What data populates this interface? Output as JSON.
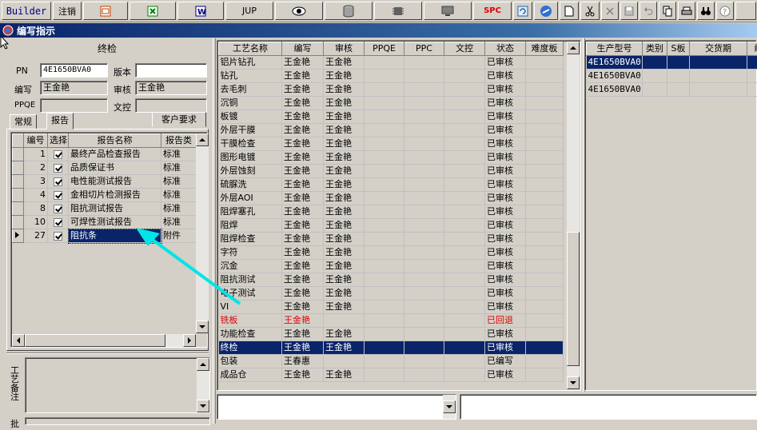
{
  "toolbar": {
    "builder": "Builder",
    "logout": "注销",
    "jup": "JUP",
    "spc": "SPC",
    "icons": [
      "word-doc-icon",
      "excel-icon",
      "word-icon",
      "eye-icon",
      "database-icon",
      "chip-icon",
      "monitor-icon",
      "refresh-icon",
      "link-icon",
      "new-file-icon",
      "cut-icon",
      "close-icon",
      "save-icon",
      "undo-icon",
      "copy-icon",
      "print-icon",
      "binoculars-icon",
      "help-icon"
    ]
  },
  "window": {
    "title": "编写指示"
  },
  "left": {
    "section_title": "终检",
    "pn_label": "PN",
    "pn_value": "4E1650BVA0",
    "version_label": "版本",
    "version_value": "",
    "writer_label": "编写",
    "writer_value": "王金艳",
    "reviewer_label": "审核",
    "reviewer_value": "王金艳",
    "ppqe_label": "PPQE",
    "ppqe_value": "",
    "doc_control_label": "文控",
    "doc_control_value": "",
    "tabs": [
      "常规",
      "报告",
      "客户要求"
    ],
    "report_headers": [
      "编号",
      "选择",
      "报告名称",
      "报告类"
    ],
    "reports": [
      {
        "no": "1",
        "checked": true,
        "name": "最终产品检查报告",
        "type": "标准"
      },
      {
        "no": "2",
        "checked": true,
        "name": "品质保证书",
        "type": "标准"
      },
      {
        "no": "3",
        "checked": true,
        "name": "电性能测试报告",
        "type": "标准"
      },
      {
        "no": "4",
        "checked": true,
        "name": "金相切片检测报告",
        "type": "标准"
      },
      {
        "no": "8",
        "checked": true,
        "name": "阻抗测试报告",
        "type": "标准"
      },
      {
        "no": "10",
        "checked": true,
        "name": "可焊性测试报告",
        "type": "标准"
      },
      {
        "no": "27",
        "checked": true,
        "name": "阻抗条",
        "type": "附件"
      }
    ],
    "process_note_label": "工艺备注",
    "bottom_label": "批"
  },
  "process": {
    "headers": [
      "工艺名称",
      "编写",
      "审核",
      "PPQE",
      "PPC",
      "文控",
      "状态",
      "难度板"
    ],
    "rows": [
      {
        "name": "铝片钻孔",
        "writer": "王金艳",
        "reviewer": "王金艳",
        "status": "已审核"
      },
      {
        "name": "钻孔",
        "writer": "王金艳",
        "reviewer": "王金艳",
        "status": "已审核"
      },
      {
        "name": "去毛刺",
        "writer": "王金艳",
        "reviewer": "王金艳",
        "status": "已审核"
      },
      {
        "name": "沉铜",
        "writer": "王金艳",
        "reviewer": "王金艳",
        "status": "已审核"
      },
      {
        "name": "板镀",
        "writer": "王金艳",
        "reviewer": "王金艳",
        "status": "已审核"
      },
      {
        "name": "外层干膜",
        "writer": "王金艳",
        "reviewer": "王金艳",
        "status": "已审核"
      },
      {
        "name": "干膜检查",
        "writer": "王金艳",
        "reviewer": "王金艳",
        "status": "已审核"
      },
      {
        "name": "图形电镀",
        "writer": "王金艳",
        "reviewer": "王金艳",
        "status": "已审核"
      },
      {
        "name": "外层蚀刻",
        "writer": "王金艳",
        "reviewer": "王金艳",
        "status": "已审核"
      },
      {
        "name": "硫脲洗",
        "writer": "王金艳",
        "reviewer": "王金艳",
        "status": "已审核"
      },
      {
        "name": "外层AOI",
        "writer": "王金艳",
        "reviewer": "王金艳",
        "status": "已审核"
      },
      {
        "name": "阻焊塞孔",
        "writer": "王金艳",
        "reviewer": "王金艳",
        "status": "已审核"
      },
      {
        "name": "阻焊",
        "writer": "王金艳",
        "reviewer": "王金艳",
        "status": "已审核"
      },
      {
        "name": "阻焊检查",
        "writer": "王金艳",
        "reviewer": "王金艳",
        "status": "已审核"
      },
      {
        "name": "字符",
        "writer": "王金艳",
        "reviewer": "王金艳",
        "status": "已审核"
      },
      {
        "name": "沉金",
        "writer": "王金艳",
        "reviewer": "王金艳",
        "status": "已审核"
      },
      {
        "name": "阻抗测试",
        "writer": "王金艳",
        "reviewer": "王金艳",
        "status": "已审核"
      },
      {
        "name": "电子测试",
        "writer": "王金艳",
        "reviewer": "王金艳",
        "status": "已审核"
      },
      {
        "name": "VI",
        "writer": "王金艳",
        "reviewer": "王金艳",
        "status": "已审核"
      },
      {
        "name": "铣板",
        "writer": "王金艳",
        "reviewer": "",
        "status": "已回退"
      },
      {
        "name": "功能检查",
        "writer": "王金艳",
        "reviewer": "王金艳",
        "status": "已审核"
      },
      {
        "name": "终检",
        "writer": "王金艳",
        "reviewer": "王金艳",
        "status": "已审核"
      },
      {
        "name": "包装",
        "writer": "王春惠",
        "reviewer": "",
        "status": "已编写"
      },
      {
        "name": "成品仓",
        "writer": "王金艳",
        "reviewer": "王金艳",
        "status": "已审核"
      }
    ]
  },
  "products": {
    "headers": [
      "生产型号",
      "类别",
      "S板",
      "交货期",
      "编"
    ],
    "rows": [
      {
        "model": "4E1650BVA0"
      },
      {
        "model": "4E1650BVA0"
      },
      {
        "model": "4E1650BVA0"
      }
    ]
  },
  "colors": {
    "selection": "#0a246a",
    "rejected": "#e00000",
    "annotation_arrow": "#00e5e5"
  }
}
